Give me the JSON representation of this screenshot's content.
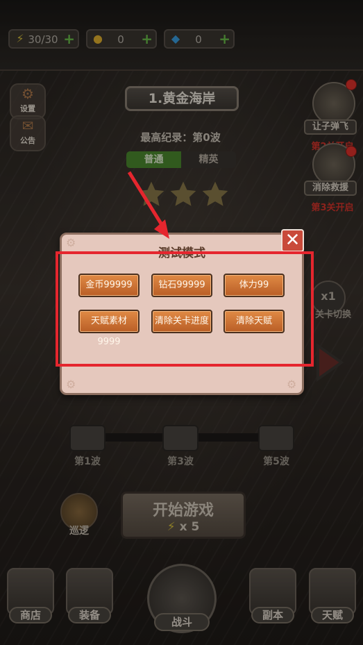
{
  "resources": {
    "energy": {
      "value": "30/30",
      "icon": "lightning-icon"
    },
    "gold": {
      "value": "0",
      "icon": "coin-icon"
    },
    "diamond": {
      "value": "0",
      "icon": "diamond-icon"
    },
    "plus": "+"
  },
  "side_menu": {
    "settings": "设置",
    "notice": "公告"
  },
  "level": {
    "title": "1.黄金海岸",
    "record": "最高纪录：第0波",
    "difficulty": [
      "普通",
      "精英"
    ],
    "stars": 3
  },
  "right_panel": {
    "item1": {
      "label": "让子弹飞",
      "unlock": "第2关开启"
    },
    "item2": {
      "label": "消除救援",
      "unlock": "第3关开启"
    },
    "speed": "x1",
    "switch_label": "关卡切换"
  },
  "dialog": {
    "title": "测试模式",
    "buttons": [
      "金币99999",
      "钻石99999",
      "体力99",
      "天赋素材9999",
      "清除关卡进度",
      "清除天赋"
    ],
    "close": "✕"
  },
  "waves": [
    "第1波",
    "第3波",
    "第5波"
  ],
  "start": {
    "title": "开始游戏",
    "cost": "x 5"
  },
  "patrol": "巡逻",
  "nav": {
    "shop": "商店",
    "equip": "装备",
    "battle": "战斗",
    "dungeon": "副本",
    "talent": "天赋"
  },
  "colors": {
    "highlight": "#e5262e",
    "button": "#d27a3a",
    "dialog_bg": "#e5c8bd"
  }
}
